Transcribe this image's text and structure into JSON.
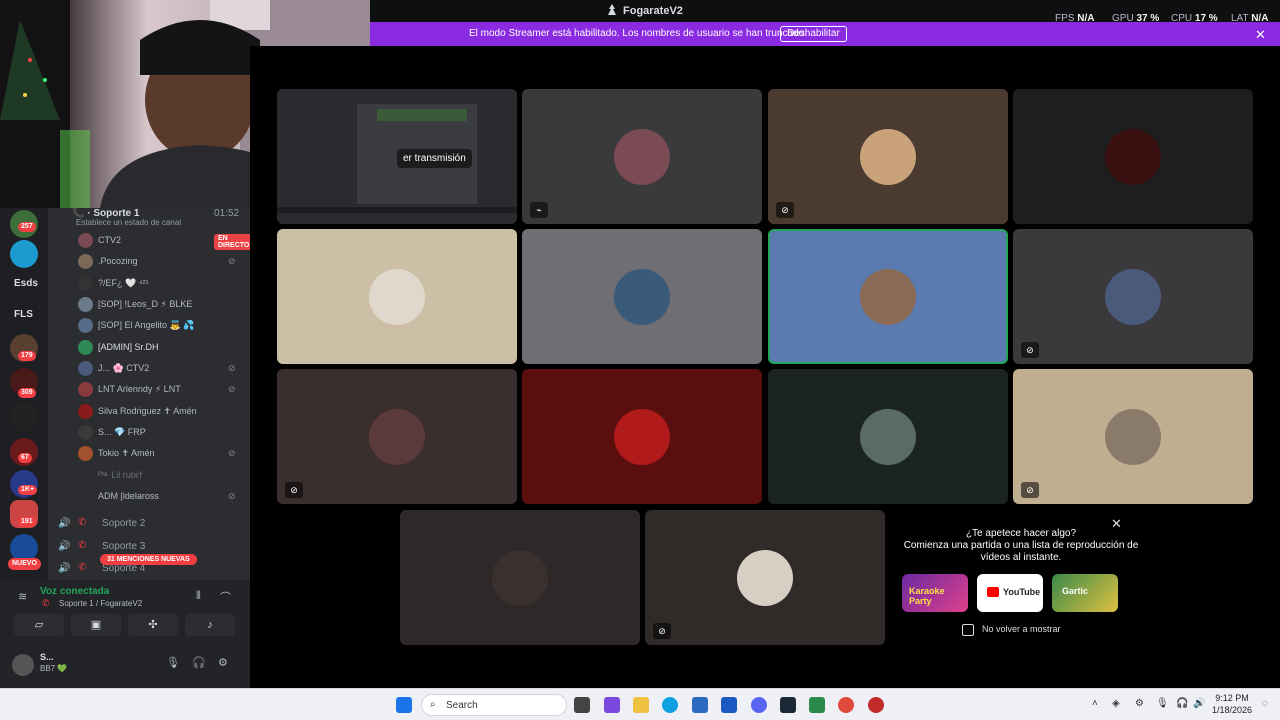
{
  "titlebar": {
    "app_title": "FogarateV2",
    "stats": [
      {
        "label": "FPS",
        "value": "N/A"
      },
      {
        "label": "GPU",
        "value": "37 %"
      },
      {
        "label": "CPU",
        "value": "17 %"
      },
      {
        "label": "LAT",
        "value": "N/A"
      }
    ]
  },
  "banner": {
    "text": "El modo Streamer está habilitado. Los nombres de usuario se han truncado.",
    "button": "Deshabilitar",
    "close": "✕",
    "color": "#8a2be2"
  },
  "rail": {
    "badges": [
      "257",
      "179",
      "309",
      "67",
      "1K+",
      "191"
    ],
    "labels": [
      "Esds",
      "FLS"
    ],
    "new_label": "NUEVO"
  },
  "channels": {
    "current": "Soporte 1",
    "current_timer": "01:52",
    "status_hint": "Establece un estado de canal",
    "live_badge": "EN DIRECTO",
    "members": [
      {
        "name": "CTV2",
        "live": true,
        "muted": false,
        "color": "#c0392b"
      },
      {
        "name": ".Pocozing",
        "live": false,
        "muted": true,
        "color": "#7a6a55"
      },
      {
        "name": "?/EF¿ 🤍 ⁴²¹",
        "live": false,
        "muted": false,
        "color": "#333"
      },
      {
        "name": "[SOP] !Leos_D ⚡ BLKE",
        "live": false,
        "muted": false,
        "color": "#6c7a89"
      },
      {
        "name": "[SOP] El Angelito 👼 💦",
        "live": false,
        "muted": false,
        "color": "#556b8a"
      },
      {
        "name": "[ADMIN] Sr.DH",
        "live": false,
        "muted": false,
        "color": "#2e8b57"
      },
      {
        "name": "J... 🌸 CTV2",
        "live": false,
        "muted": true,
        "color": "#4a5a7a"
      },
      {
        "name": "LNT Arlenndy ⚡ LNT",
        "live": false,
        "muted": true,
        "color": "#8a3a3a"
      },
      {
        "name": "Silva Rodriguez ✝ Amén",
        "live": false,
        "muted": false,
        "color": "#8b1a1a"
      },
      {
        "name": "S... 💎 FRP",
        "live": false,
        "muted": false,
        "color": "#3a3a3a"
      },
      {
        "name": "Tokio ✝ Amén",
        "live": false,
        "muted": true,
        "color": "#a0522d"
      },
      {
        "name": "ᴾᴺᴸ Lil rubi†",
        "live": false,
        "muted": false,
        "color": "#2b2d31"
      },
      {
        "name": "ADM |ldelaross",
        "live": false,
        "muted": true,
        "color": "#2b2d31"
      }
    ],
    "voice_channels": [
      "Soporte 2",
      "Soporte 3",
      "Soporte 4"
    ],
    "mentions": "31 MENCIONES NUEVAS"
  },
  "voice_panel": {
    "title": "Voz conectada",
    "subtitle": "Soporte 1 / FogarateV2",
    "user_name": "S...",
    "user_status": "BB7 💚"
  },
  "stream_tile": {
    "label": "er transmisión"
  },
  "tiles": [
    {
      "bg": "#3a3a3d",
      "ava": "#7a4a55",
      "muted": true,
      "border": false,
      "icon": "stream"
    },
    {
      "bg": "#4a3a30",
      "ava": "#c9a27a",
      "muted": true,
      "border": false,
      "icon": "mute"
    },
    {
      "bg": "#1e1e20",
      "ava": "#3a1010",
      "muted": false,
      "border": false,
      "icon": ""
    },
    {
      "bg": "#cdbfa5",
      "ava": "#e0d8cc",
      "muted": false,
      "border": false,
      "icon": ""
    },
    {
      "bg": "#6e6e74",
      "ava": "#3a5a7a",
      "muted": false,
      "border": false,
      "icon": ""
    },
    {
      "bg": "#5a7ab0",
      "ava": "#8a6a55",
      "muted": false,
      "border": true,
      "icon": ""
    },
    {
      "bg": "#3a3a3d",
      "ava": "#4a5a7a",
      "muted": true,
      "border": false,
      "icon": "mute"
    },
    {
      "bg": "#3a2e2e",
      "ava": "#5a3a3a",
      "muted": true,
      "border": false,
      "icon": "mute"
    },
    {
      "bg": "#5a0e0e",
      "ava": "#b01a1a",
      "muted": false,
      "border": false,
      "icon": ""
    },
    {
      "bg": "#1c2422",
      "ava": "#5a6a66",
      "muted": false,
      "border": false,
      "icon": ""
    },
    {
      "bg": "#c0ae90",
      "ava": "#8a7a6a",
      "muted": true,
      "border": false,
      "icon": "mute"
    },
    {
      "bg": "#2e2828",
      "ava": "#3a3030",
      "muted": false,
      "border": false,
      "icon": ""
    },
    {
      "bg": "#302a28",
      "ava": "#d8cfc4",
      "muted": true,
      "border": false,
      "icon": "mute"
    }
  ],
  "activity": {
    "title": "¿Te apetece hacer algo?",
    "desc": "Comienza una partida o una lista de reproducción de vídeos al instante.",
    "cards": [
      "Karaoke Party",
      "YouTube",
      "Gartic"
    ],
    "checkbox_label": "No volver a mostrar"
  },
  "taskbar": {
    "search": "Search",
    "time": "9:12 PM",
    "date": "1/18/2026"
  }
}
